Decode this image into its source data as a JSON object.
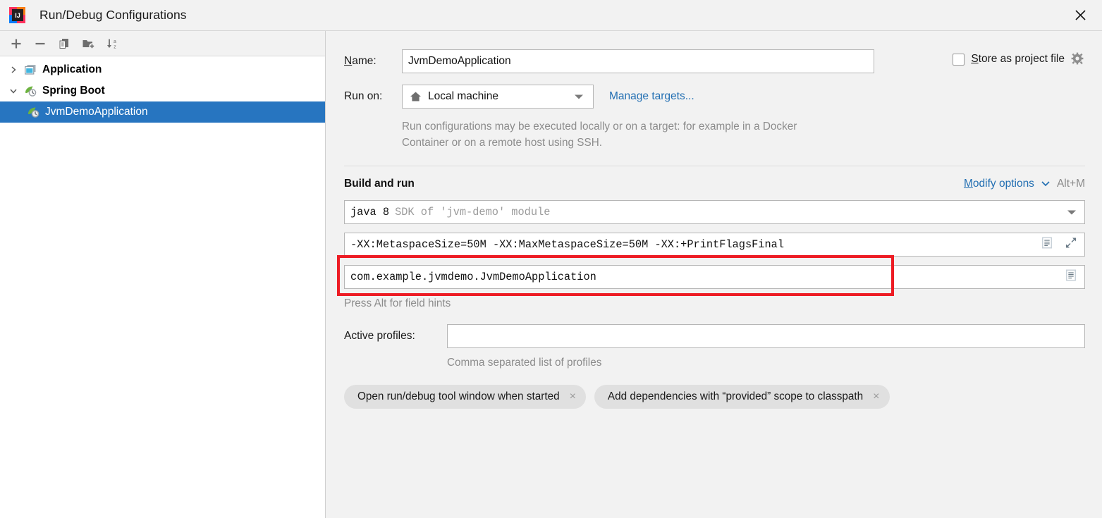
{
  "window": {
    "title": "Run/Debug Configurations",
    "app_icon": "intellij-idea-icon",
    "close_label": "✕"
  },
  "toolbar": {
    "buttons": [
      {
        "name": "add-configuration-button",
        "icon": "plus-icon"
      },
      {
        "name": "remove-configuration-button",
        "icon": "minus-icon"
      },
      {
        "name": "copy-configuration-button",
        "icon": "copy-icon"
      },
      {
        "name": "new-folder-button",
        "icon": "folder-add-icon"
      },
      {
        "name": "sort-configurations-button",
        "icon": "sort-alpha-icon"
      }
    ]
  },
  "tree": {
    "nodes": [
      {
        "label": "Application",
        "icon": "application-icon",
        "expanded": false,
        "twisty": "chevron-right-icon",
        "selected": false,
        "level": 0
      },
      {
        "label": "Spring Boot",
        "icon": "spring-boot-icon",
        "expanded": true,
        "twisty": "chevron-down-icon",
        "selected": false,
        "level": 0
      },
      {
        "label": "JvmDemoApplication",
        "icon": "spring-boot-icon",
        "expanded": false,
        "twisty": "",
        "selected": true,
        "level": 1
      }
    ]
  },
  "form": {
    "name_label_prefix": "N",
    "name_label_rest": "ame:",
    "name_value": "JvmDemoApplication",
    "store_checkbox_checked": false,
    "store_label_prefix": "S",
    "store_label_rest": "tore as project file",
    "store_gear_icon": "gear-icon",
    "run_on_label": "Run on:",
    "run_on_value": "Local machine",
    "run_on_icon": "home-icon",
    "manage_targets_link_prefix": "",
    "manage_targets_link": "Manage targets...",
    "description": "Run configurations may be executed locally or on a target: for example in a Docker Container or on a remote host using SSH."
  },
  "build_and_run": {
    "section_title": "Build and run",
    "modify_options_prefix": "M",
    "modify_options_rest": "odify options",
    "modify_options_caret": "chevron-down-icon",
    "modify_options_shortcut": "Alt+M",
    "sdk_value": "java 8",
    "sdk_description": "SDK of 'jvm-demo' module",
    "vm_options_value": "-XX:MetaspaceSize=50M -XX:MaxMetaspaceSize=50M -XX:+PrintFlagsFinal",
    "vm_options_icons": [
      "macro-list-icon",
      "expand-editor-icon"
    ],
    "main_class_value": "com.example.jvmdemo.JvmDemoApplication",
    "main_class_icon": "macro-list-icon",
    "field_hint": "Press Alt for field hints",
    "active_profiles_label": "Active profiles:",
    "active_profiles_value": "",
    "active_profiles_note": "Comma separated list of profiles",
    "chips": [
      {
        "label": "Open run/debug tool window when started",
        "close": "×"
      },
      {
        "label": "Add dependencies with “provided” scope to classpath",
        "close": "×"
      }
    ]
  },
  "annotation": {
    "color": "#ed1c24",
    "target": "vm-options-field"
  },
  "colors": {
    "selection_blue": "#2775c0",
    "link_blue": "#2470b3",
    "panel_bg": "#f2f2f2",
    "field_bg": "#ffffff",
    "muted_text": "#8c8c8c"
  }
}
